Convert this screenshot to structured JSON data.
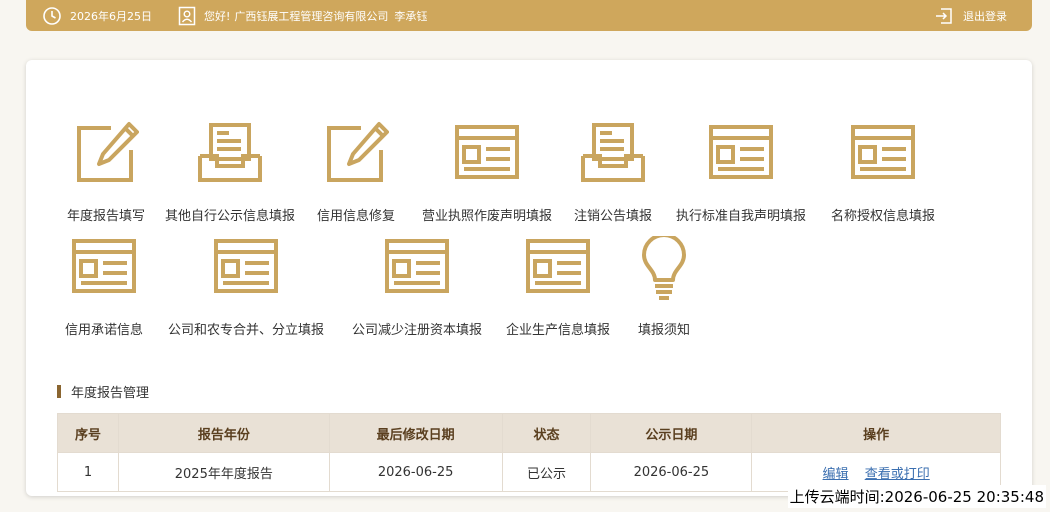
{
  "header": {
    "date": "2026年6月25日",
    "greeting": "您好!",
    "company": "广西钰展工程管理咨询有限公司",
    "user": "李承钰",
    "logout": "退出登录"
  },
  "tiles": [
    {
      "label": "年度报告填写",
      "icon": "pencil-doc-icon"
    },
    {
      "label": "其他自行公示信息填报",
      "icon": "inbox-tray-icon"
    },
    {
      "label": "信用信息修复",
      "icon": "pencil-doc-icon"
    },
    {
      "label": "营业执照作废声明填报",
      "icon": "form-window-icon"
    },
    {
      "label": "注销公告填报",
      "icon": "inbox-tray-icon"
    },
    {
      "label": "执行标准自我声明填报",
      "icon": "form-window-icon"
    },
    {
      "label": "名称授权信息填报",
      "icon": "form-window-icon"
    },
    {
      "label": "信用承诺信息",
      "icon": "form-window-icon"
    },
    {
      "label": "公司和农专合并、分立填报",
      "icon": "form-window-icon"
    },
    {
      "label": "公司减少注册资本填报",
      "icon": "form-window-icon"
    },
    {
      "label": "企业生产信息填报",
      "icon": "form-window-icon"
    },
    {
      "label": "填报须知",
      "icon": "lightbulb-icon"
    }
  ],
  "section": {
    "title": "年度报告管理"
  },
  "table": {
    "headers": [
      "序号",
      "报告年份",
      "最后修改日期",
      "状态",
      "公示日期",
      "操作"
    ],
    "rows": [
      {
        "no": "1",
        "year": "2025年年度报告",
        "modified": "2026-06-25",
        "status": "已公示",
        "published": "2026-06-25",
        "edit": "编辑",
        "view": "查看或打印"
      }
    ]
  },
  "footer": {
    "upload_time": "上传云端时间:2026-06-25 20:35:48"
  },
  "colors": {
    "accent": "#cfa75c",
    "icon": "#c9a55f",
    "header_bg": "#e9e1d6",
    "link": "#3b6fb0"
  }
}
